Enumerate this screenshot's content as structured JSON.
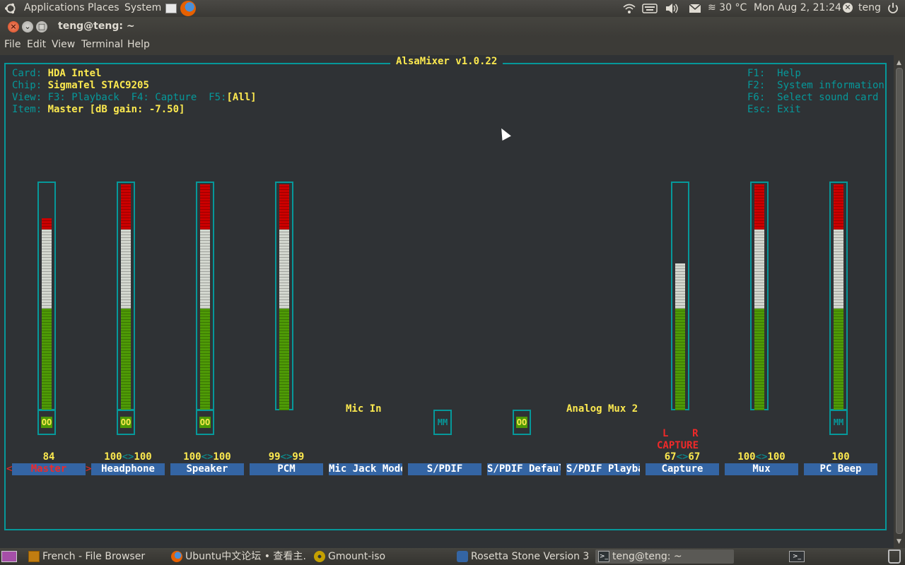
{
  "top_panel": {
    "applications": "Applications",
    "places": "Places",
    "system": "System",
    "weather": "≋ 30 °C",
    "datetime": "Mon Aug  2, 21:24",
    "user": "teng",
    "icons": [
      "ubuntu-logo-icon",
      "launcher-icon",
      "firefox-icon",
      "wifi-icon",
      "keyboard-icon",
      "volume-icon",
      "mail-icon",
      "user-status-icon",
      "power-icon"
    ]
  },
  "window": {
    "title": "teng@teng: ~"
  },
  "menu": {
    "file": "File",
    "edit": "Edit",
    "view": "View",
    "terminal": "Terminal",
    "help": "Help"
  },
  "mixer": {
    "title": "AlsaMixer v1.0.22",
    "card_label": "Card: ",
    "card": "HDA Intel",
    "chip_label": "Chip: ",
    "chip": "SigmaTel STAC9205",
    "view_label": "View: F3: Playback  F4: Capture  F5:",
    "view_value": "[All]",
    "item_label": "Item: ",
    "item": "Master [dB gain: -7.50]",
    "keys": [
      "F1:  Help",
      "F2:  System information",
      "F6:  Select sound card",
      "Esc: Exit"
    ],
    "capture_lr": "L    R",
    "capture_text": "CAPTURE",
    "sel_left": "<",
    "sel_right": ">",
    "channels": [
      {
        "name": "Master",
        "value": "84",
        "level": 84,
        "switch": "OO",
        "switch_on": true,
        "selected": true
      },
      {
        "name": "Headphone",
        "value_l": "100",
        "value_r": "100",
        "level": 100,
        "switch": "OO",
        "switch_on": true
      },
      {
        "name": "Speaker",
        "value_l": "100",
        "value_r": "100",
        "level": 100,
        "switch": "OO",
        "switch_on": true
      },
      {
        "name": "PCM",
        "value_l": "99",
        "value_r": "99",
        "level": 99
      },
      {
        "name": "Mic Jack Mode",
        "enum": "Mic In"
      },
      {
        "name": "S/PDIF",
        "switch": "MM",
        "switch_on": false
      },
      {
        "name": "S/PDIF Defaul",
        "switch": "OO",
        "switch_on": true
      },
      {
        "name": "S/PDIF Playba",
        "enum": "Analog Mux 2"
      },
      {
        "name": "Capture",
        "value_l": "67",
        "value_r": "67",
        "level": 67
      },
      {
        "name": "Mux",
        "value_l": "100",
        "value_r": "100",
        "level": 100
      },
      {
        "name": "PC Beep",
        "value": "100",
        "level": 100,
        "switch": "MM",
        "switch_on": false
      }
    ]
  },
  "taskbar": [
    {
      "label": "French - File Browser",
      "icon": "folder-icon"
    },
    {
      "label": "Ubuntu中文论坛 • 查看主…",
      "icon": "firefox-icon"
    },
    {
      "label": "Gmount-iso",
      "icon": "disc-icon"
    },
    {
      "label": "Rosetta Stone Version 3",
      "icon": "rosetta-icon"
    },
    {
      "label": "teng@teng: ~",
      "icon": "terminal-icon"
    }
  ],
  "colors": {
    "cyan": "#06989a",
    "yellow": "#fce94f",
    "green": "#4e9a06",
    "white": "#d3d7cf",
    "red": "#cc0000",
    "blue": "#3465a4"
  }
}
